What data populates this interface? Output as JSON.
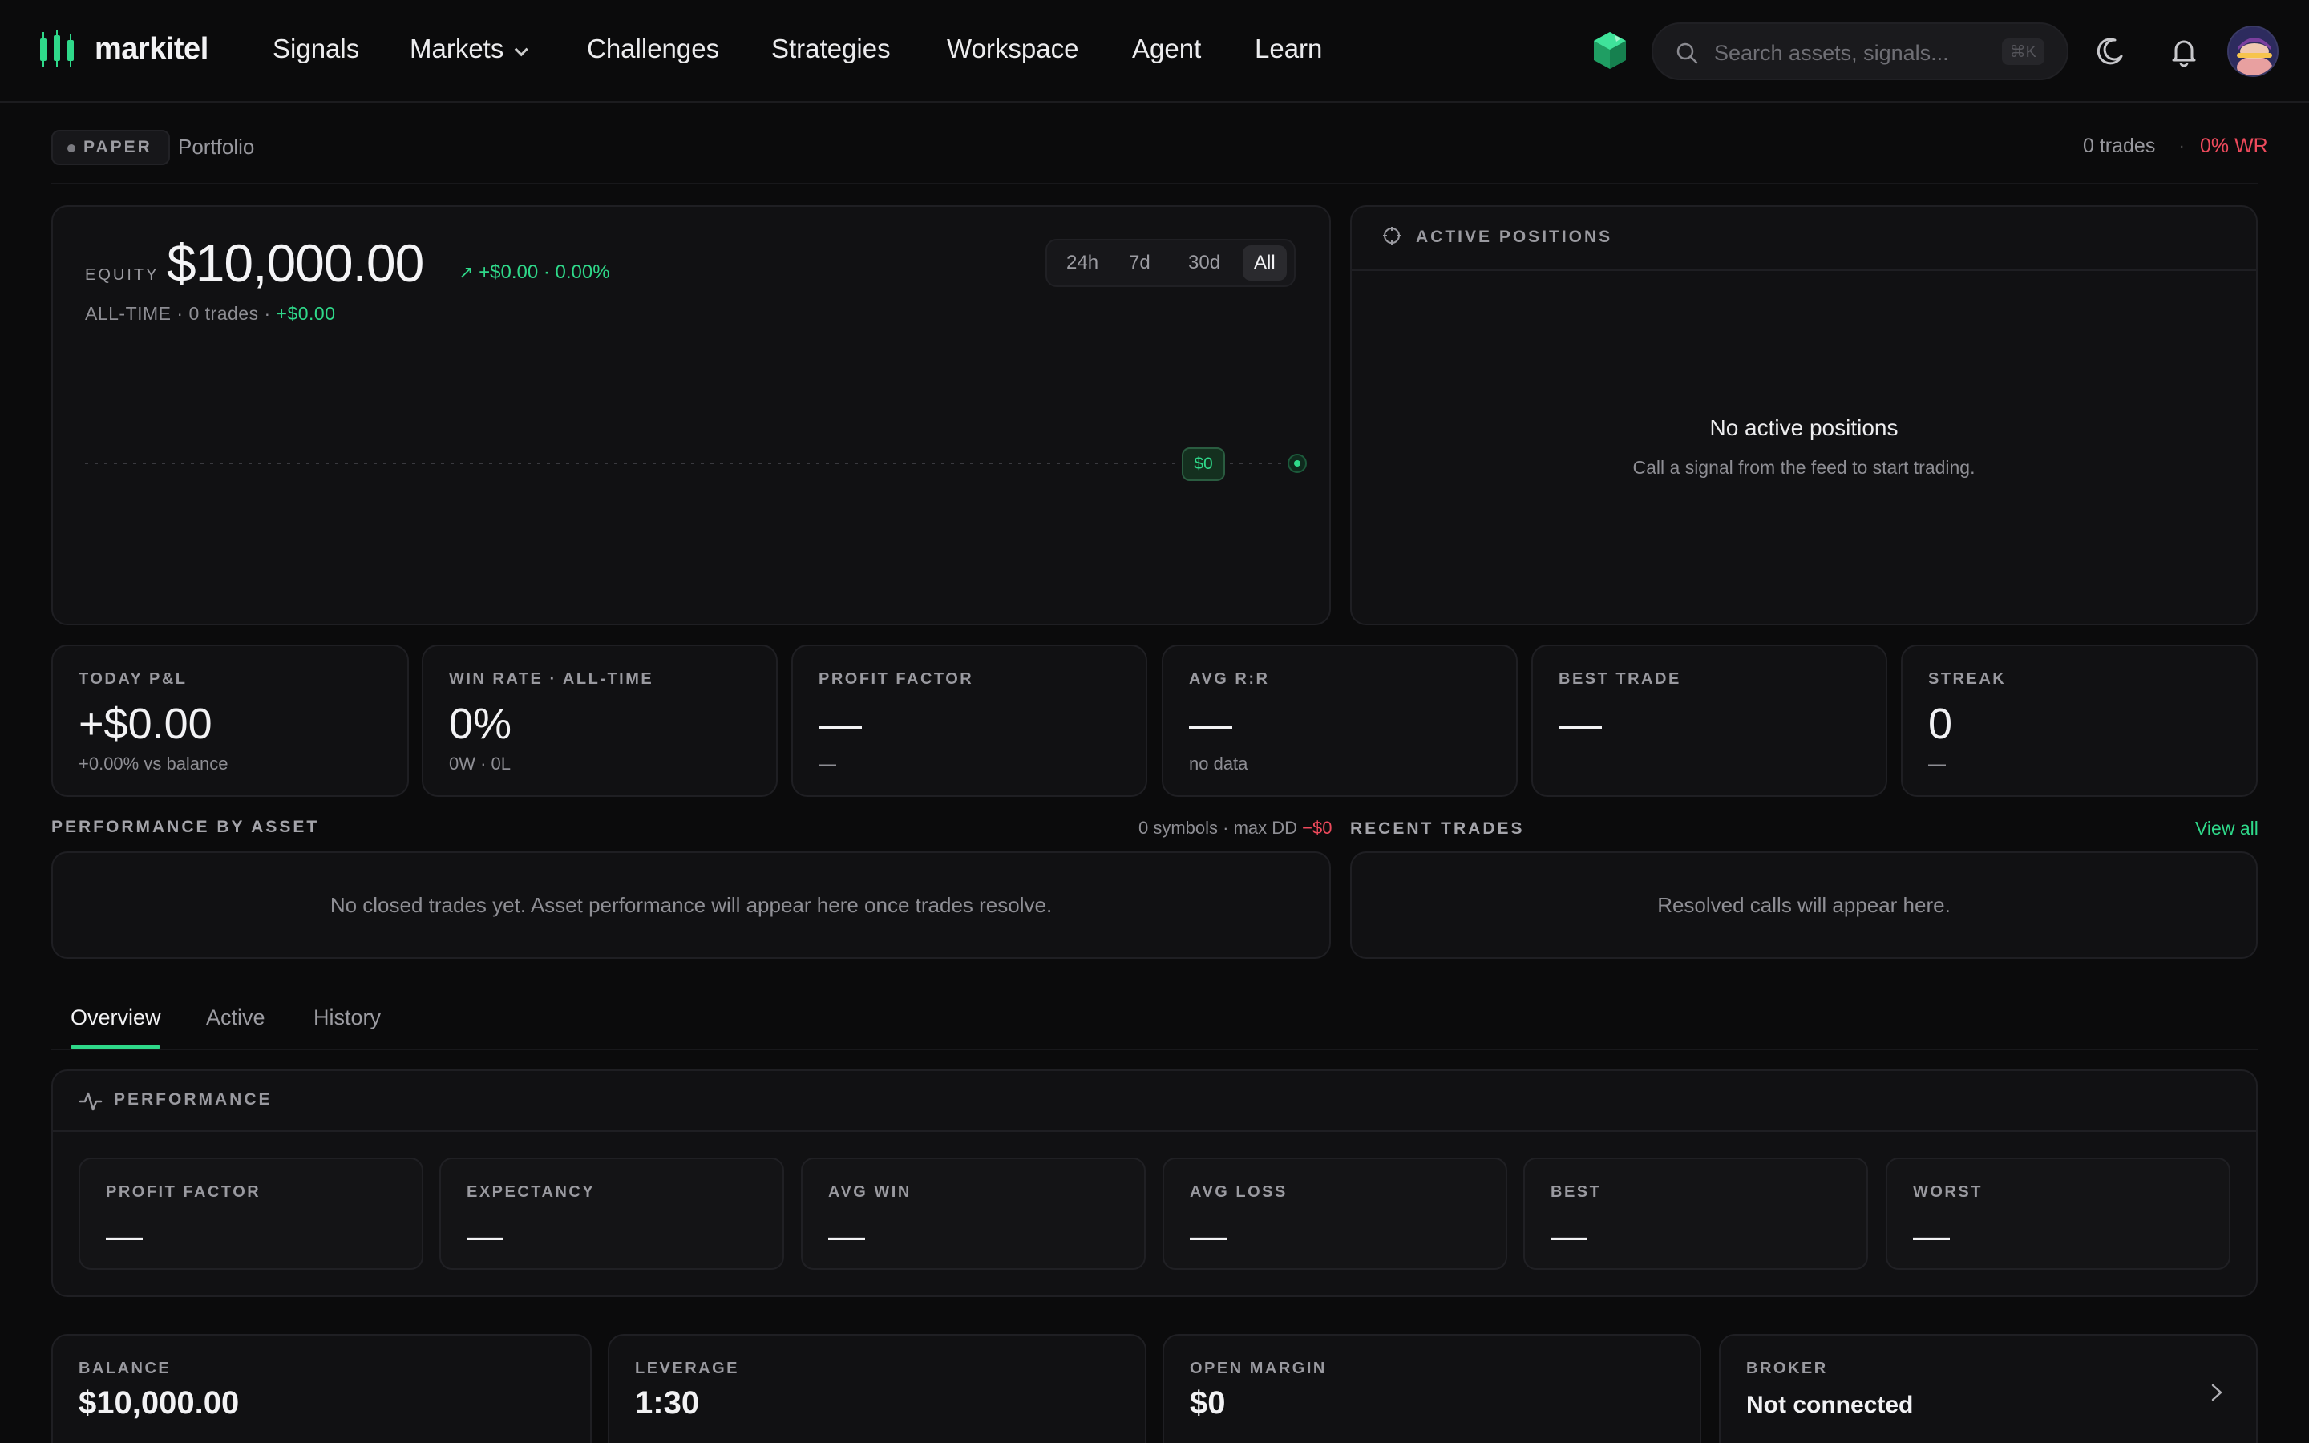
{
  "nav": {
    "brand": "markitel",
    "links": [
      "Signals",
      "Markets",
      "Challenges",
      "Strategies",
      "Workspace",
      "Agent",
      "Learn"
    ],
    "search_placeholder": "Search assets, signals...",
    "search_shortcut": "⌘K",
    "icons": [
      "gem-icon",
      "search-icon",
      "moon-icon",
      "bell-icon",
      "avatar"
    ]
  },
  "subheader": {
    "badge": "PAPER",
    "title": "Portfolio",
    "trades": "0 trades",
    "separator": "·",
    "win_rate": "0% WR"
  },
  "equity": {
    "label": "EQUITY",
    "value": "$10,000.00",
    "change": "+$0.00 · 0.00%",
    "sub_prefix": "ALL-TIME · 0 trades · ",
    "sub_amount": "+$0.00",
    "ranges": [
      "24h",
      "7d",
      "30d",
      "All"
    ],
    "active_range": "All",
    "marker_label": "$0"
  },
  "active_positions": {
    "title": "ACTIVE POSITIONS",
    "empty_title": "No active positions",
    "empty_sub": "Call a signal from the feed to start trading."
  },
  "stats": [
    {
      "label": "TODAY P&L",
      "value": "+$0.00",
      "sub": "+0.00% vs balance"
    },
    {
      "label": "WIN RATE · ALL-TIME",
      "value": "0%",
      "sub": "0W · 0L"
    },
    {
      "label": "PROFIT FACTOR",
      "value": "—",
      "sub": "—"
    },
    {
      "label": "AVG R:R",
      "value": "—",
      "sub": "no data"
    },
    {
      "label": "BEST TRADE",
      "value": "—",
      "sub": ""
    },
    {
      "label": "STREAK",
      "value": "0",
      "sub": "—"
    }
  ],
  "perf_by_asset": {
    "title": "PERFORMANCE BY ASSET",
    "meta_prefix": "0 symbols · max DD ",
    "meta_dd": "−$0",
    "empty": "No closed trades yet. Asset performance will appear here once trades resolve."
  },
  "recent_trades": {
    "title": "RECENT TRADES",
    "view_all": "View all",
    "empty": "Resolved calls will appear here."
  },
  "tabs": [
    "Overview",
    "Active",
    "History"
  ],
  "performance": {
    "title": "PERFORMANCE",
    "cards": [
      {
        "label": "PROFIT FACTOR",
        "value": "—"
      },
      {
        "label": "EXPECTANCY",
        "value": "—"
      },
      {
        "label": "AVG WIN",
        "value": "—"
      },
      {
        "label": "AVG LOSS",
        "value": "—"
      },
      {
        "label": "BEST",
        "value": "—"
      },
      {
        "label": "WORST",
        "value": "—"
      }
    ]
  },
  "account": [
    {
      "label": "BALANCE",
      "value": "$10,000.00"
    },
    {
      "label": "LEVERAGE",
      "value": "1:30"
    },
    {
      "label": "OPEN MARGIN",
      "value": "$0"
    },
    {
      "label": "BROKER",
      "value": "Not connected"
    }
  ],
  "colors": {
    "accent": "#2fd98a",
    "negative": "#ee4a5c",
    "background": "#0b0b0c"
  }
}
